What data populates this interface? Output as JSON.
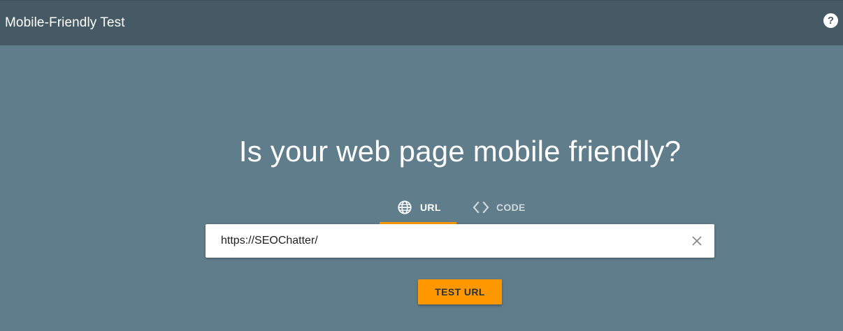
{
  "appbar": {
    "title": "Mobile-Friendly Test",
    "help_label": "?"
  },
  "main": {
    "headline": "Is your web page mobile friendly?",
    "tabs": [
      {
        "label": "URL",
        "icon": "globe-icon",
        "selected": true
      },
      {
        "label": "CODE",
        "icon": "code-icon",
        "selected": false
      }
    ],
    "url_input": {
      "value": "https://SEOChatter/"
    },
    "test_button_label": "TEST URL"
  },
  "colors": {
    "appbar": "#455a64",
    "background": "#607d8b",
    "accent": "#ff9800"
  }
}
